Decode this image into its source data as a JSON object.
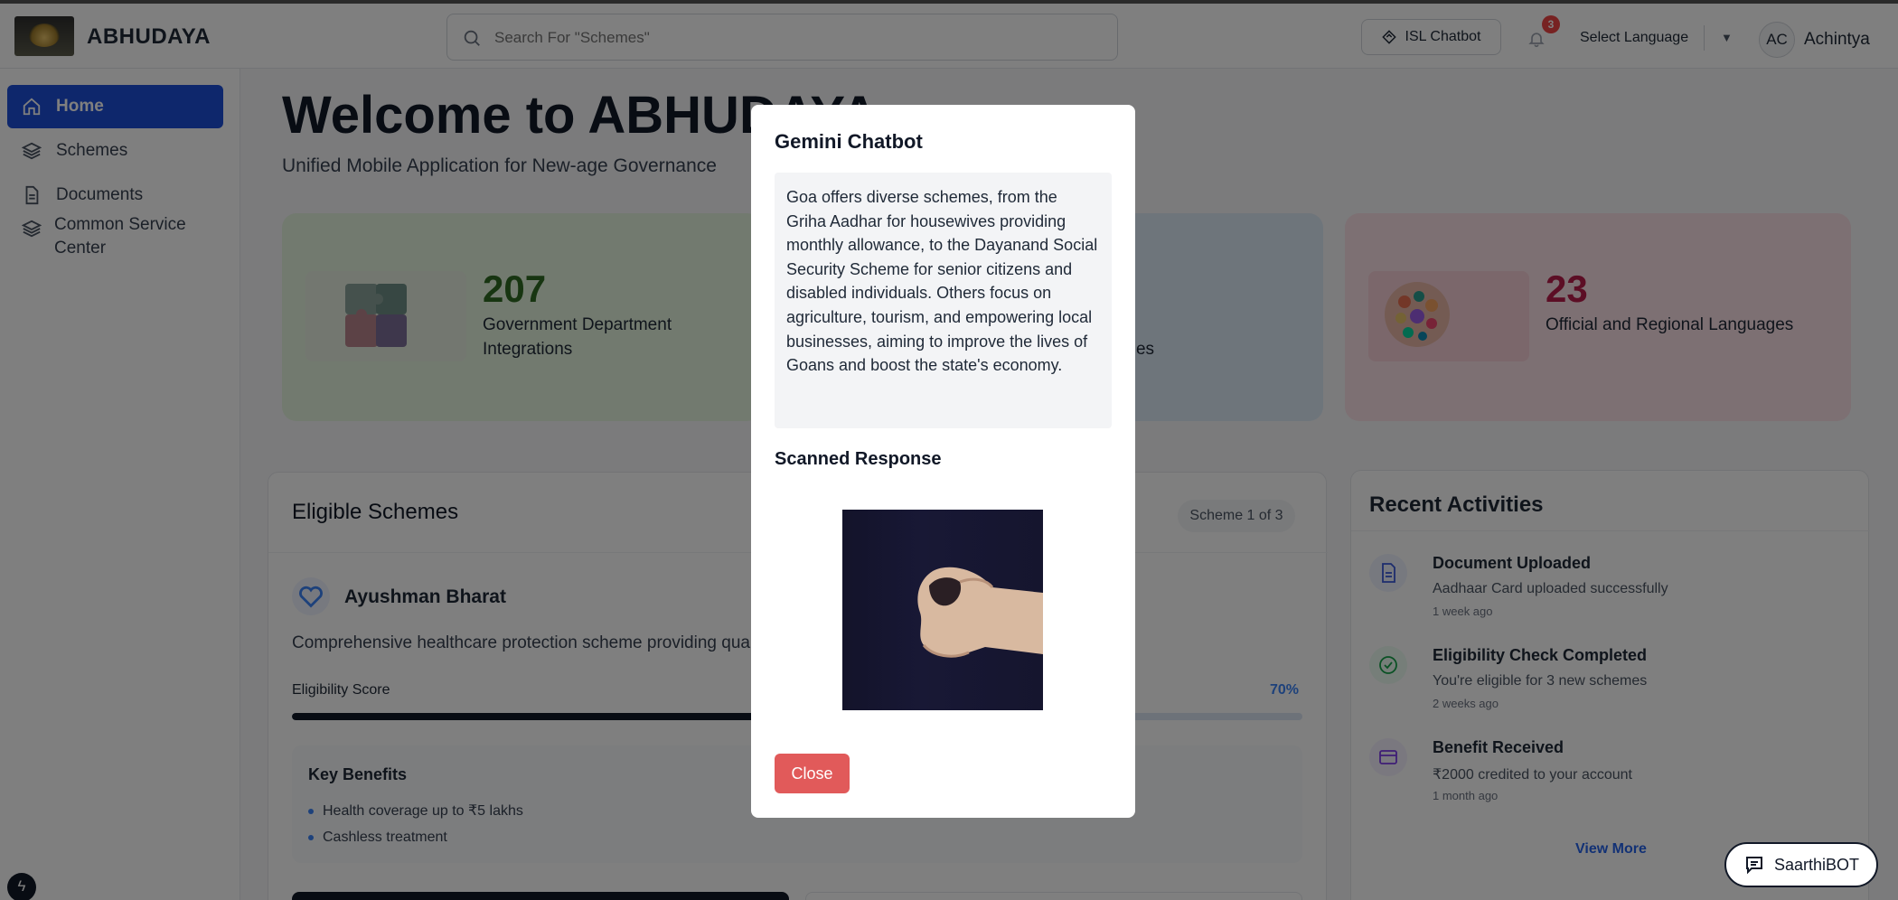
{
  "header": {
    "brand": "ABHUDAYA",
    "search_placeholder": "Search For \"Schemes\"",
    "isl_chatbot": "ISL Chatbot",
    "notification_count": "3",
    "select_language": "Select Language",
    "avatar_initials": "AC",
    "user_name": "Achintya"
  },
  "sidebar": {
    "items": [
      {
        "label": "Home",
        "icon": "home-icon",
        "active": true
      },
      {
        "label": "Schemes",
        "icon": "layers-icon"
      },
      {
        "label": "Documents",
        "icon": "document-icon"
      },
      {
        "label": "Common Service Center",
        "icon": "layers-icon"
      }
    ]
  },
  "main": {
    "welcome": "Welcome to ABHUDAYA",
    "subtitle": "Unified Mobile Application for New-age Governance",
    "stats": [
      {
        "value": "207",
        "label": "Government Department Integrations",
        "color": "#2f6b23"
      },
      {
        "label_partial": "te",
        "label_partial2": "hemes"
      },
      {
        "value": "23",
        "label": "Official and Regional Languages",
        "color": "#b91c4b"
      }
    ],
    "eligible": {
      "title": "Eligible Schemes",
      "pager": "Scheme 1 of 3",
      "scheme_name": "Ayushman Bharat",
      "scheme_desc": "Comprehensive healthcare protection scheme providing qua",
      "score_label": "Eligibility Score",
      "score_value": "70%",
      "score_fraction": 0.7,
      "benefits_title": "Key Benefits",
      "benefits": [
        "Health coverage up to ₹5 lakhs",
        "Cashless treatment"
      ]
    },
    "recent": {
      "title": "Recent Activities",
      "items": [
        {
          "title": "Document Uploaded",
          "desc": "Aadhaar Card uploaded successfully",
          "time": "1 week ago",
          "icon": "document-icon"
        },
        {
          "title": "Eligibility Check Completed",
          "desc": "You're eligible for 3 new schemes",
          "time": "2 weeks ago",
          "icon": "check-circle-icon"
        },
        {
          "title": "Benefit Received",
          "desc": "₹2000 credited to your account",
          "time": "1 month ago",
          "icon": "credit-card-icon"
        }
      ],
      "view_more": "View More"
    }
  },
  "modal": {
    "title": "Gemini Chatbot",
    "message": "Goa offers diverse schemes, from the Griha Aadhar for housewives providing monthly allowance, to the Dayanand Social Security Scheme for senior citizens and disabled individuals. Others focus on agriculture, tourism, and empowering local businesses, aiming to improve the lives of Goans and boost the state's economy.",
    "scanned_title": "Scanned Response",
    "close": "Close"
  },
  "saarthi": "SaarthiBOT",
  "colors": {
    "primary": "#1d4ed8",
    "close_button": "#e15a5a",
    "badge": "#ef4444"
  }
}
